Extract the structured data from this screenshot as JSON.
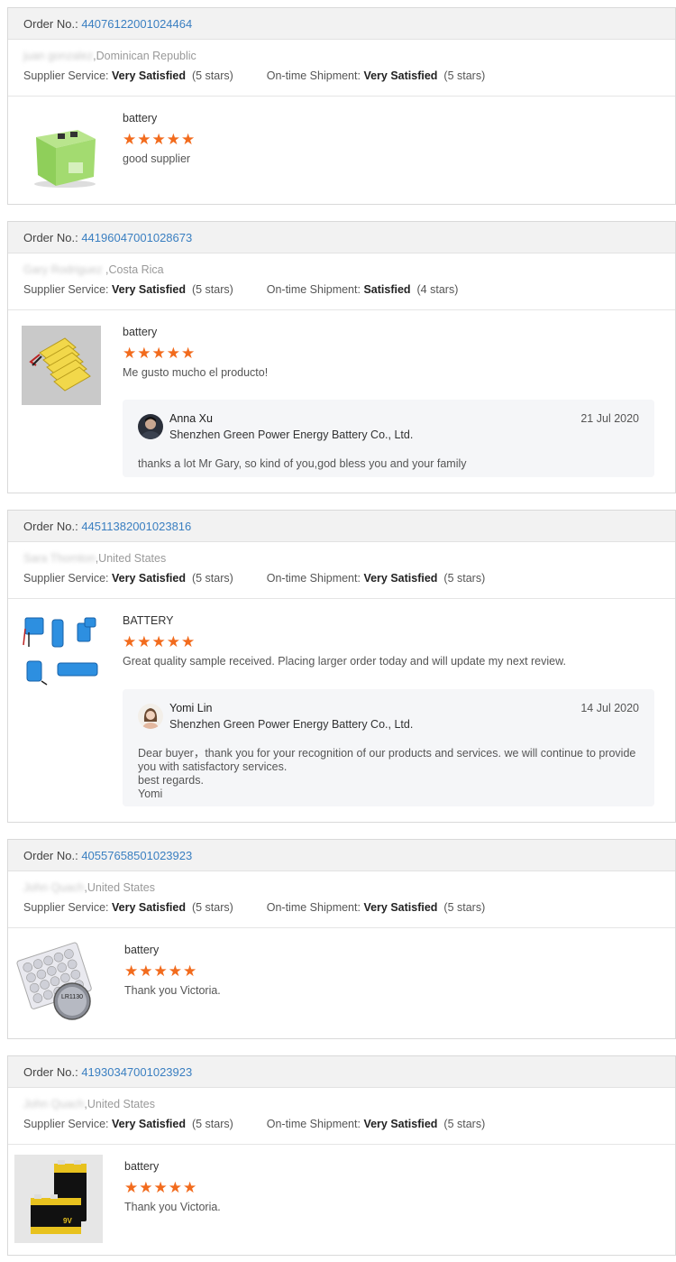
{
  "labels": {
    "order_no": "Order No.:",
    "supplier_service": "Supplier Service:",
    "ontime_shipment": "On-time Shipment:"
  },
  "accent_color": "#3a7fc1",
  "star_color": "#f26b1d",
  "reviews": [
    {
      "order_no": "44076122001024464",
      "buyer_name": "juan gonzalez",
      "buyer_country": ",Dominican Republic",
      "supplier_service": "Very Satisfied",
      "supplier_stars": "(5 stars)",
      "shipment": "Very Satisfied",
      "shipment_stars": "(5 stars)",
      "product": "battery",
      "rating": 5,
      "comment": "good supplier",
      "thumb_icon": "green-battery-pack"
    },
    {
      "order_no": "44196047001028673",
      "buyer_name": "Gary Rodriguez",
      "buyer_country": " ,Costa Rica",
      "supplier_service": "Very Satisfied",
      "supplier_stars": "(5 stars)",
      "shipment": "Satisfied",
      "shipment_stars": "(4 stars)",
      "product": "battery",
      "rating": 5,
      "comment": "Me gusto mucho el producto!",
      "thumb_icon": "lipo-battery-cells",
      "reply": {
        "name": "Anna Xu",
        "company": "Shenzhen Green Power Energy Battery Co., Ltd.",
        "date": "21 Jul 2020",
        "text": "thanks a lot Mr Gary, so kind of you,god bless you and your family"
      }
    },
    {
      "order_no": "44511382001023816",
      "buyer_name": "Sara Thornton",
      "buyer_country": ",United States",
      "supplier_service": "Very Satisfied",
      "supplier_stars": "(5 stars)",
      "shipment": "Very Satisfied",
      "shipment_stars": "(5 stars)",
      "product": "BATTERY",
      "rating": 5,
      "comment": "Great quality sample received. Placing larger order today and will update my next review.",
      "thumb_icon": "blue-battery-packs",
      "reply": {
        "name": "Yomi Lin",
        "company": "Shenzhen Green Power Energy Battery Co., Ltd.",
        "date": "14 Jul 2020",
        "text": "Dear buyer，thank you for your recognition of our products and services. we will continue to provide you with satisfactory services.\nbest regards.\nYomi"
      }
    },
    {
      "order_no": "40557658501023923",
      "buyer_name": "John Quach",
      "buyer_country": ",United States",
      "supplier_service": "Very Satisfied",
      "supplier_stars": "(5 stars)",
      "shipment": "Very Satisfied",
      "shipment_stars": "(5 stars)",
      "product": "battery",
      "rating": 5,
      "comment": "Thank you Victoria.",
      "thumb_icon": "coin-cell-batteries",
      "thumb_text": "LR1130"
    },
    {
      "order_no": "41930347001023923",
      "buyer_name": "John Quach",
      "buyer_country": ",United States",
      "supplier_service": "Very Satisfied",
      "supplier_stars": "(5 stars)",
      "shipment": "Very Satisfied",
      "shipment_stars": "(5 stars)",
      "product": "battery",
      "rating": 5,
      "comment": "Thank you Victoria.",
      "thumb_icon": "9v-batteries",
      "thumb_text": "9V"
    }
  ]
}
